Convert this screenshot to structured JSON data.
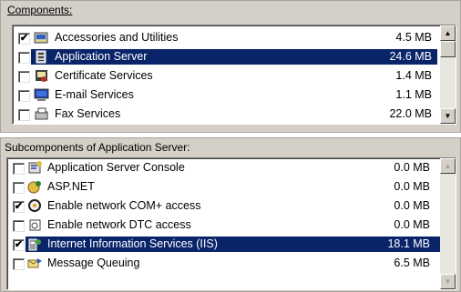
{
  "components": {
    "group_label": "Components:",
    "items": [
      {
        "label": "Accessories and Utilities",
        "size": "4.5 MB",
        "checked": "✔",
        "icon": "accessories-icon",
        "selected": false
      },
      {
        "label": "Application Server",
        "size": "24.6 MB",
        "checked": "",
        "icon": "application-server-icon",
        "selected": true
      },
      {
        "label": "Certificate Services",
        "size": "1.4 MB",
        "checked": "",
        "icon": "certificate-icon",
        "selected": false
      },
      {
        "label": "E-mail Services",
        "size": "1.1 MB",
        "checked": "",
        "icon": "email-services-icon",
        "selected": false
      },
      {
        "label": "Fax Services",
        "size": "22.0 MB",
        "checked": "",
        "icon": "fax-icon",
        "selected": false
      }
    ]
  },
  "subcomponents": {
    "group_label": "Subcomponents of Application Server:",
    "items": [
      {
        "label": "Application Server Console",
        "size": "0.0 MB",
        "checked": "",
        "icon": "console-icon",
        "selected": false
      },
      {
        "label": "ASP.NET",
        "size": "0.0 MB",
        "checked": "",
        "icon": "aspnet-icon",
        "selected": false
      },
      {
        "label": "Enable network COM+ access",
        "size": "0.0 MB",
        "checked": "✔",
        "icon": "com-plus-icon",
        "selected": false
      },
      {
        "label": "Enable network DTC access",
        "size": "0.0 MB",
        "checked": "",
        "icon": "dtc-icon",
        "selected": false
      },
      {
        "label": "Internet Information Services (IIS)",
        "size": "18.1 MB",
        "checked": "✔",
        "icon": "iis-icon",
        "selected": true
      },
      {
        "label": "Message Queuing",
        "size": "6.5 MB",
        "checked": "",
        "icon": "message-queuing-icon",
        "selected": false
      }
    ]
  },
  "colors": {
    "selection": "#0a246a",
    "dialog": "#d4d0c8"
  }
}
